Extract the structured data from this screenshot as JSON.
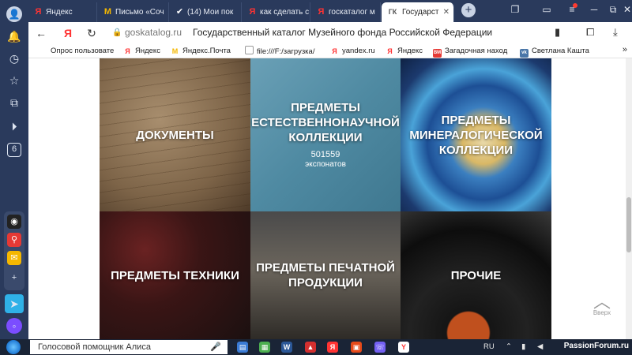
{
  "tabs": [
    {
      "label": "Яндекс",
      "favicon": "Я",
      "favicon_color": "#ff3333"
    },
    {
      "label": "Письмо «Соч",
      "favicon": "M",
      "favicon_color": "#f5b700"
    },
    {
      "label": "(14) Мои пок",
      "favicon": "✔",
      "favicon_color": "#ffffff"
    },
    {
      "label": "как сделать с",
      "favicon": "Я",
      "favicon_color": "#ff3333"
    },
    {
      "label": "госкаталог м",
      "favicon": "Я",
      "favicon_color": "#ff3333"
    },
    {
      "label": "Государст",
      "favicon": "ГК",
      "favicon_color": "#555555",
      "active": true
    }
  ],
  "address": {
    "domain": "goskatalog.ru",
    "title": "Государственный каталог Музейного фонда Российской Федерации"
  },
  "bookmarks": [
    {
      "label": "Опрос пользовате",
      "icon": "",
      "color": "#ffffff"
    },
    {
      "label": "Яндекс",
      "icon": "Я",
      "color": "#ff3333"
    },
    {
      "label": "Яндекс.Почта",
      "icon": "M",
      "color": "#f5b700"
    },
    {
      "label": "file:///F:/загрузка/",
      "icon": "",
      "color": "#ffffff"
    },
    {
      "label": "yandex.ru",
      "icon": "Я",
      "color": "#ff3333"
    },
    {
      "label": "Яндекс",
      "icon": "Я",
      "color": "#ff3333"
    },
    {
      "label": "Загадочная наход",
      "icon": "ВМ",
      "color": "#e53935"
    },
    {
      "label": "Светлана Кашта",
      "icon": "vk",
      "color": "#4a76a8"
    }
  ],
  "tiles": [
    {
      "title": "Документы"
    },
    {
      "title": "Предметы естественнонаучной коллекции",
      "count": "501559",
      "unit": "экспонатов"
    },
    {
      "title": "Предметы минералогической коллекции"
    },
    {
      "title": "Предметы техники"
    },
    {
      "title": "Предметы печатной продукции"
    },
    {
      "title": "Прочие"
    }
  ],
  "scroll_top_label": "Вверх",
  "taskbar": {
    "assistant_placeholder": "Голосовой помощник Алиса",
    "language": "RU",
    "watermark": "PassionForum.ru"
  },
  "sidepanel": {
    "counter": "6"
  }
}
